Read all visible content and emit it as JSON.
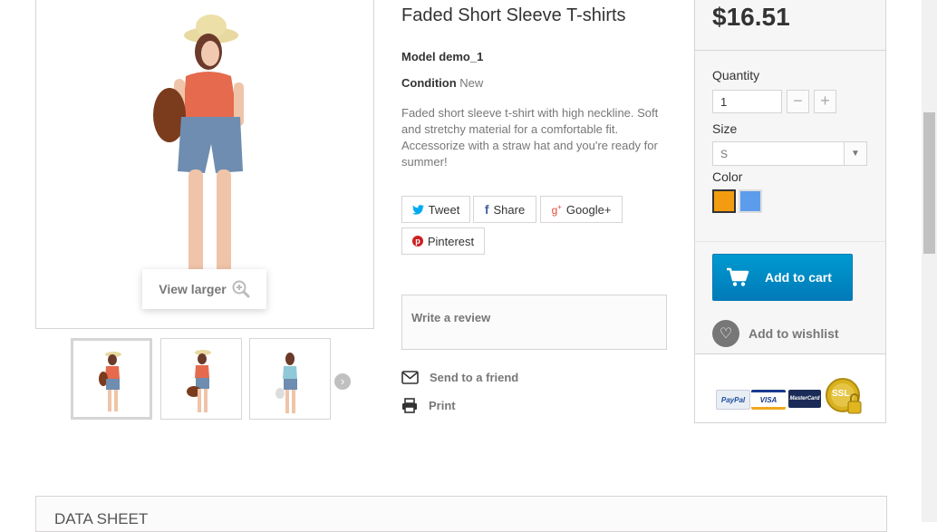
{
  "product": {
    "title": "Faded Short Sleeve T-shirts",
    "model_label": "Model",
    "model_value": "demo_1",
    "condition_label": "Condition",
    "condition_value": "New",
    "description": "Faded short sleeve t-shirt with high neckline. Soft and stretchy material for a comfortable fit. Accessorize with a straw hat and you're ready for summer!",
    "view_larger": "View larger"
  },
  "social": {
    "tweet": "Tweet",
    "share": "Share",
    "google": "Google+",
    "pinterest": "Pinterest"
  },
  "review": {
    "label": "Write a review"
  },
  "links": {
    "send_friend": "Send to a friend",
    "print": "Print"
  },
  "buy_box": {
    "price": "$16.51",
    "quantity_label": "Quantity",
    "quantity_value": "1",
    "size_label": "Size",
    "size_value": "S",
    "color_label": "Color",
    "colors": [
      "#f39c11",
      "#5d9cec"
    ],
    "add_to_cart": "Add to cart",
    "add_to_wishlist": "Add to wishlist",
    "payment_logos": [
      "PayPal",
      "VISA",
      "MasterCard",
      "SSL"
    ]
  },
  "data_sheet": {
    "title": "DATA SHEET"
  },
  "colors": {
    "accent": "#0079b6",
    "border": "#d6d4d4",
    "muted_text": "#777777"
  }
}
